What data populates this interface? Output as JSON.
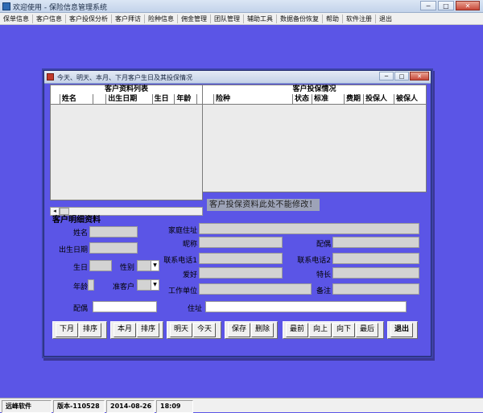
{
  "window": {
    "title": "欢迎使用 - 保险信息管理系统"
  },
  "menu": [
    "保单信息",
    "客户信息",
    "客户投保分析",
    "客户拜访",
    "险种信息",
    "佣金管理",
    "团队管理",
    "辅助工具",
    "数据备份恢复",
    "帮助",
    "软件注册",
    "退出"
  ],
  "dialog": {
    "title": "今天、明天、本月、下月客户生日及其投保情况",
    "customer_list": {
      "title": "客户资料列表",
      "columns": [
        "姓名",
        "出生日期",
        "生日",
        "年龄"
      ],
      "rows": []
    },
    "policy_list": {
      "title": "客户投保情况",
      "columns": [
        "险种",
        "状态",
        "标准",
        "费期",
        "投保人",
        "被保人"
      ],
      "rows": []
    },
    "notice": "客户投保资料此处不能修改！",
    "detail": {
      "title": "客户明细资料",
      "labels": {
        "name": "姓名",
        "birthdate": "出生日期",
        "birthday": "生日",
        "gender": "性别",
        "age": "年龄",
        "prospect": "准客户",
        "home_address": "家庭住址",
        "nickname": "昵称",
        "spouse": "配偶",
        "phone1": "联系电话1",
        "phone2": "联系电话2",
        "hobby": "爱好",
        "specialty": "特长",
        "work_unit": "工作单位",
        "remark": "备注",
        "spouse2": "配偶",
        "address": "住址"
      },
      "values": {
        "name": "",
        "birthdate": "",
        "birthday": "",
        "gender": "",
        "age": "",
        "prospect": "",
        "home_address": "",
        "nickname": "",
        "spouse": "",
        "phone1": "",
        "phone2": "",
        "hobby": "",
        "specialty": "",
        "work_unit": "",
        "remark": "",
        "spouse2": "",
        "address": ""
      }
    },
    "buttons": {
      "next_month": "下月",
      "sort1": "排序",
      "this_month": "本月",
      "sort2": "排序",
      "tomorrow": "明天",
      "today": "今天",
      "save": "保存",
      "delete": "删除",
      "first": "最前",
      "up": "向上",
      "down": "向下",
      "last": "最后",
      "exit": "退出"
    }
  },
  "statusbar": {
    "company": "远峰软件",
    "version": "版本-110528",
    "date": "2014-08-26",
    "time": "18:09"
  },
  "colors": {
    "background": "#5b55e6",
    "dialog_border": "#222c6e"
  }
}
